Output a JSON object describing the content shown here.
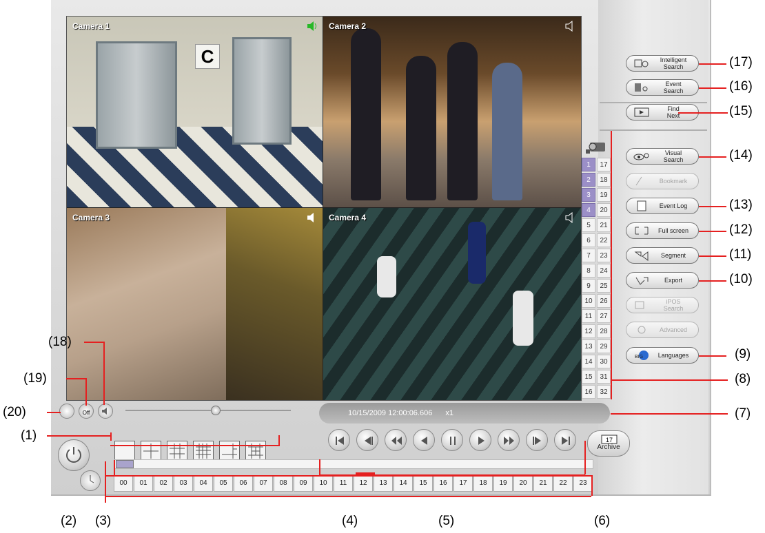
{
  "window": {
    "title": ""
  },
  "cameras": [
    {
      "label": "Camera 1",
      "audio_icon": "speaker-active-icon",
      "audio_color": "#27b827"
    },
    {
      "label": "Camera 2",
      "audio_icon": "speaker-icon",
      "audio_color": "#ffffff"
    },
    {
      "label": "Camera 3",
      "audio_icon": "speaker-icon",
      "audio_color": "#ffffff"
    },
    {
      "label": "Camera 4",
      "audio_icon": "speaker-icon",
      "audio_color": "#ffffff"
    }
  ],
  "channels": {
    "col1": [
      "1",
      "2",
      "3",
      "4",
      "5",
      "6",
      "7",
      "8",
      "9",
      "10",
      "11",
      "12",
      "13",
      "14",
      "15",
      "16"
    ],
    "col2": [
      "17",
      "18",
      "19",
      "20",
      "21",
      "22",
      "23",
      "24",
      "25",
      "26",
      "27",
      "28",
      "29",
      "30",
      "31",
      "32"
    ],
    "active": [
      "1",
      "2",
      "3",
      "4"
    ],
    "active_color": "#9b8fc7"
  },
  "status": {
    "datetime": "10/15/2009 12:00:06.606",
    "speed": "x1"
  },
  "archive": {
    "day": "17",
    "label": "Archive"
  },
  "timeline": {
    "hours": [
      "00",
      "01",
      "02",
      "03",
      "04",
      "05",
      "06",
      "07",
      "08",
      "09",
      "10",
      "11",
      "12",
      "13",
      "14",
      "15",
      "16",
      "17",
      "18",
      "19",
      "20",
      "21",
      "22",
      "23"
    ],
    "current_hour": "12"
  },
  "right_buttons": [
    {
      "label": "Intelligent\nSearch",
      "icon": "intelligent-search-icon",
      "enabled": true,
      "callout": "(17)"
    },
    {
      "label": "Event\nSearch",
      "icon": "event-search-icon",
      "enabled": true,
      "callout": "(16)"
    },
    {
      "label": "Find\nNext",
      "icon": "film-icon",
      "enabled": true,
      "callout": "(15)"
    },
    {
      "label": "Visual\nSearch",
      "icon": "eye-search-icon",
      "enabled": true,
      "callout": "(14)"
    },
    {
      "label": "Bookmark",
      "icon": "bookmark-icon",
      "enabled": false,
      "callout": ""
    },
    {
      "label": "Event Log",
      "icon": "document-icon",
      "enabled": true,
      "callout": "(13)"
    },
    {
      "label": "Full screen",
      "icon": "fullscreen-icon",
      "enabled": true,
      "callout": "(12)"
    },
    {
      "label": "Segment",
      "icon": "segment-icon",
      "enabled": true,
      "callout": "(11)"
    },
    {
      "label": "Export",
      "icon": "export-icon",
      "enabled": true,
      "callout": "(10)"
    },
    {
      "label": "iPOS\nSearch",
      "icon": "pos-search-icon",
      "enabled": false,
      "callout": ""
    },
    {
      "label": "Advanced",
      "icon": "advanced-icon",
      "enabled": false,
      "callout": ""
    },
    {
      "label": "Languages",
      "icon": "globe-icon",
      "enabled": true,
      "callout": "(9)"
    }
  ],
  "playback": [
    "first-icon",
    "prev-frame-icon",
    "rewind-icon",
    "reverse-play-icon",
    "pause-icon",
    "play-icon",
    "fast-forward-icon",
    "next-frame-icon",
    "last-icon"
  ],
  "split_modes": [
    "split-1-icon",
    "split-4-icon",
    "split-9-icon",
    "split-16-icon",
    "split-6-icon",
    "split-13-icon"
  ],
  "callouts": {
    "c1": "(1)",
    "c2": "(2)",
    "c3": "(3)",
    "c4": "(4)",
    "c5": "(5)",
    "c6": "(6)",
    "c7": "(7)",
    "c8": "(8)",
    "c18": "(18)",
    "c19": "(19)",
    "c20": "(20)"
  },
  "small_buttons": {
    "audio_off_label": "Off"
  }
}
